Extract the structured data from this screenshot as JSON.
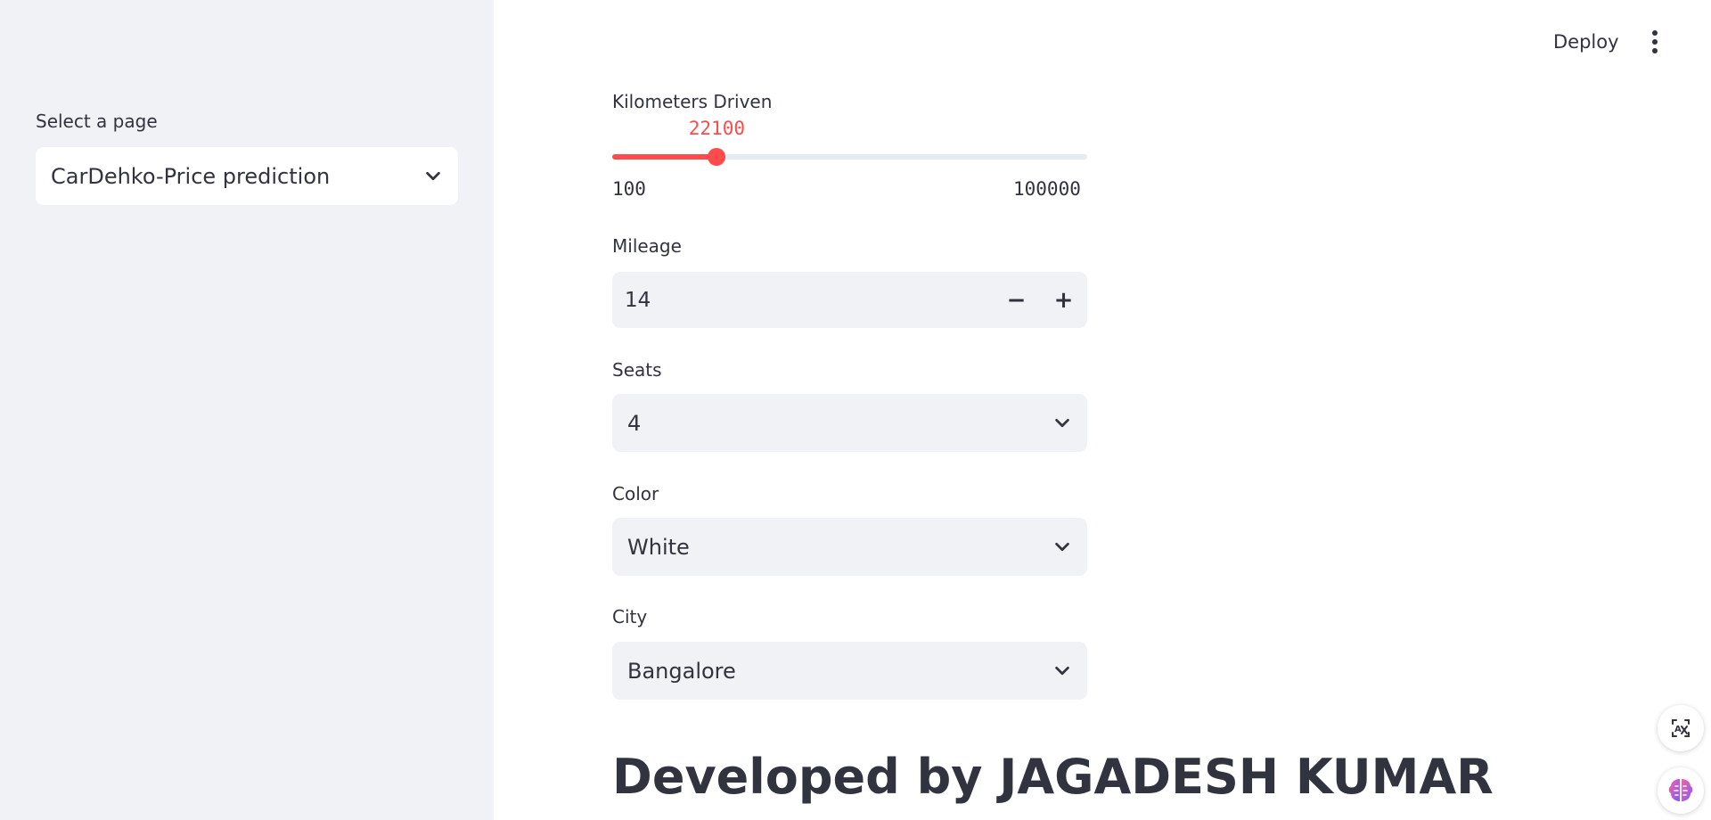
{
  "sidebar": {
    "page_select_label": "Select a page",
    "page_select_value": "CarDehko-Price prediction"
  },
  "header": {
    "deploy_label": "Deploy",
    "menu_icon": "kebab-menu-icon"
  },
  "form": {
    "kilometers": {
      "label": "Kilometers Driven",
      "value": "22100",
      "min": "100",
      "max": "100000",
      "accent": "#ff4b4b"
    },
    "mileage": {
      "label": "Mileage",
      "value": "14",
      "decrement": "−",
      "increment": "+"
    },
    "seats": {
      "label": "Seats",
      "value": "4"
    },
    "color": {
      "label": "Color",
      "value": "White"
    },
    "city": {
      "label": "City",
      "value": "Bangalore"
    }
  },
  "footer": {
    "title": "Developed by JAGADESH KUMAR"
  },
  "floating": {
    "translate_icon": "translate-icon",
    "assistant_icon": "brain-icon"
  }
}
